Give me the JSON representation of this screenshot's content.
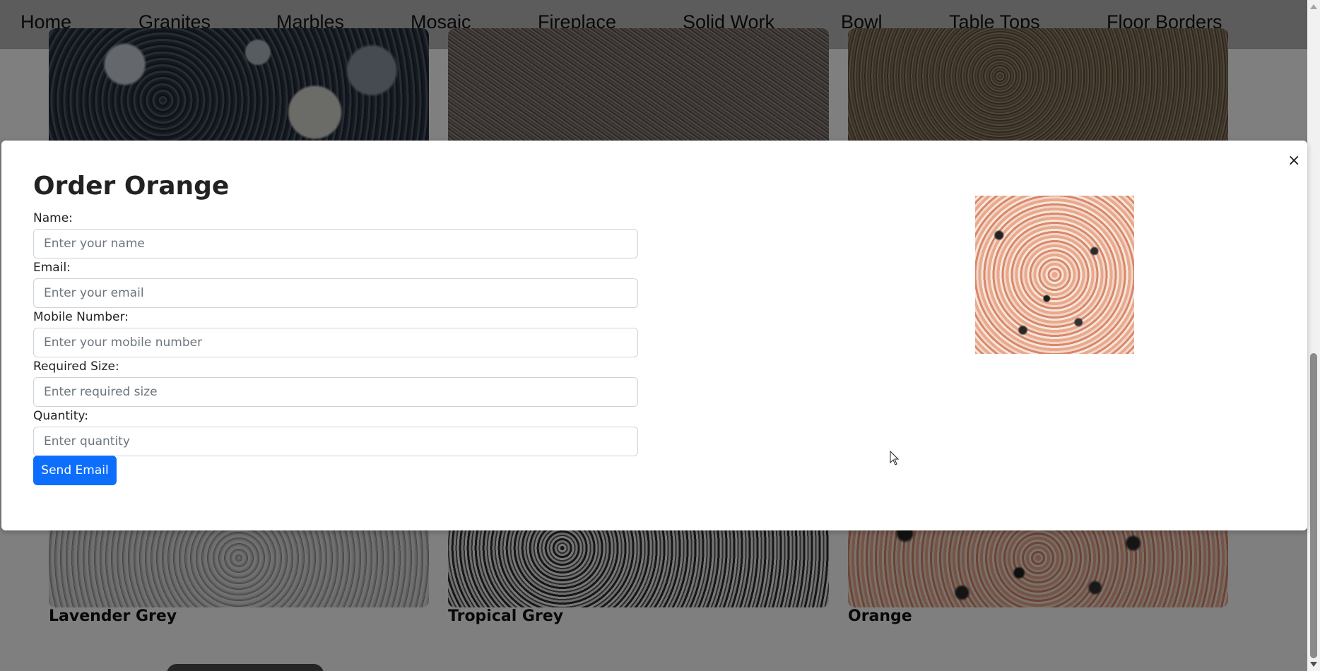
{
  "nav": {
    "items": [
      "Home",
      "Granites",
      "Marbles",
      "Mosaic",
      "Fireplace",
      "Solid Work",
      "Bowl",
      "Table Tops",
      "Floor Borders"
    ]
  },
  "gallery": {
    "tiles": [
      {
        "label": ""
      },
      {
        "label": ""
      },
      {
        "label": ""
      },
      {
        "label": "Lavender Grey"
      },
      {
        "label": "Tropical Grey"
      },
      {
        "label": "Orange"
      }
    ]
  },
  "modal": {
    "title": "Order Orange",
    "close_label": "×",
    "fields": [
      {
        "label": "Name:",
        "placeholder": "Enter your name"
      },
      {
        "label": "Email:",
        "placeholder": "Enter your email"
      },
      {
        "label": "Mobile Number:",
        "placeholder": "Enter your mobile number"
      },
      {
        "label": "Required Size:",
        "placeholder": "Enter required size"
      },
      {
        "label": "Quantity:",
        "placeholder": "Enter quantity"
      }
    ],
    "submit_label": "Send Email",
    "preview_icon": "orange-granite-image"
  },
  "colors": {
    "primary_button": "#0d6efd",
    "navbar": "#b9b9b9",
    "overlay": "rgba(0,0,0,0.5)"
  }
}
